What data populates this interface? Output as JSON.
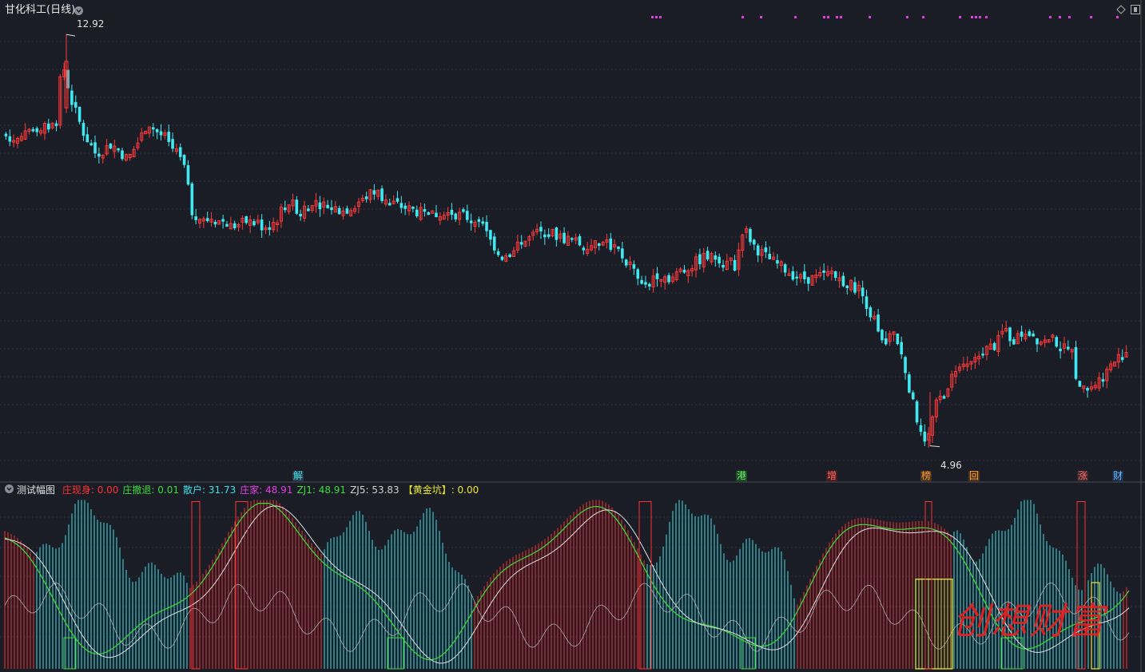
{
  "header": {
    "stock_title": "甘化科工(日线)",
    "high_label": "12.92",
    "low_label": "4.96"
  },
  "indicator": {
    "name": "测试幅图",
    "items": [
      {
        "label": "庄现身:",
        "value": "0.00",
        "color": "#ff3030"
      },
      {
        "label": "庄撤退:",
        "value": "0.01",
        "color": "#3cdc3c"
      },
      {
        "label": "散户:",
        "value": "31.73",
        "color": "#40e0e8"
      },
      {
        "label": "庄家:",
        "value": "48.91",
        "color": "#e040e0"
      },
      {
        "label": "ZJ1:",
        "value": "48.91",
        "color": "#3cdc3c"
      },
      {
        "label": "ZJ5:",
        "value": "53.83",
        "color": "#cfcfcf"
      },
      {
        "label": "【黄金坑】:",
        "value": "0.00",
        "color": "#e8e830"
      }
    ]
  },
  "event_tags": [
    {
      "text": "解",
      "color": "#40e0e8",
      "bg": "#2a3a48"
    },
    {
      "text": "港",
      "color": "#6cf06c",
      "bg": "#1d4a22"
    },
    {
      "text": "增",
      "color": "#ff6a6a",
      "bg": "#4a1d1d"
    },
    {
      "text": "榜",
      "color": "#ff9a3a",
      "bg": "#4a341d"
    },
    {
      "text": "回",
      "color": "#ff9a3a",
      "bg": "#4a341d"
    },
    {
      "text": "涨",
      "color": "#ff6a6a",
      "bg": "#3a2a2a"
    },
    {
      "text": "财",
      "color": "#6ab8ff",
      "bg": "#1d2e48"
    }
  ],
  "watermark": "创想财富",
  "colors": {
    "up": "#ff3a3a",
    "down": "#40e8f0",
    "signal": "#e040e0",
    "grid": "#30323c"
  },
  "chart_data": [
    {
      "type": "candlestick",
      "title": "甘化科工(日线)",
      "ylim": [
        4.6,
        13.2
      ],
      "y_axis_labels_shown": false,
      "max": 12.92,
      "min": 4.96,
      "approx_close_path": [
        [
          0,
          11.0
        ],
        [
          20,
          10.9
        ],
        [
          40,
          11.0
        ],
        [
          55,
          11.1
        ],
        [
          70,
          11.2
        ],
        [
          78,
          12.4
        ],
        [
          90,
          11.6
        ],
        [
          105,
          11.0
        ],
        [
          120,
          10.6
        ],
        [
          140,
          10.8
        ],
        [
          160,
          10.5
        ],
        [
          175,
          10.9
        ],
        [
          185,
          11.2
        ],
        [
          200,
          11.0
        ],
        [
          215,
          10.7
        ],
        [
          230,
          10.4
        ],
        [
          240,
          9.5
        ],
        [
          255,
          9.3
        ],
        [
          270,
          9.4
        ],
        [
          290,
          9.2
        ],
        [
          310,
          9.3
        ],
        [
          330,
          9.2
        ],
        [
          345,
          9.3
        ],
        [
          360,
          9.7
        ],
        [
          375,
          9.5
        ],
        [
          390,
          9.7
        ],
        [
          410,
          9.6
        ],
        [
          430,
          9.5
        ],
        [
          450,
          9.7
        ],
        [
          470,
          9.9
        ],
        [
          485,
          9.7
        ],
        [
          500,
          9.6
        ],
        [
          520,
          9.5
        ],
        [
          540,
          9.4
        ],
        [
          560,
          9.5
        ],
        [
          580,
          9.4
        ],
        [
          600,
          9.3
        ],
        [
          615,
          8.9
        ],
        [
          630,
          8.6
        ],
        [
          645,
          8.8
        ],
        [
          665,
          9.0
        ],
        [
          685,
          9.1
        ],
        [
          700,
          9.0
        ],
        [
          720,
          8.9
        ],
        [
          740,
          8.8
        ],
        [
          760,
          8.9
        ],
        [
          775,
          8.7
        ],
        [
          790,
          8.4
        ],
        [
          805,
          8.0
        ],
        [
          820,
          8.3
        ],
        [
          840,
          8.2
        ],
        [
          860,
          8.4
        ],
        [
          880,
          8.6
        ],
        [
          900,
          8.6
        ],
        [
          920,
          8.4
        ],
        [
          930,
          9.2
        ],
        [
          945,
          8.8
        ],
        [
          960,
          8.6
        ],
        [
          980,
          8.4
        ],
        [
          1000,
          8.2
        ],
        [
          1020,
          8.2
        ],
        [
          1040,
          8.3
        ],
        [
          1060,
          8.1
        ],
        [
          1075,
          8.0
        ],
        [
          1085,
          7.7
        ],
        [
          1095,
          7.3
        ],
        [
          1105,
          6.9
        ],
        [
          1115,
          7.1
        ],
        [
          1125,
          6.9
        ],
        [
          1135,
          6.3
        ],
        [
          1145,
          5.6
        ],
        [
          1155,
          5.2
        ],
        [
          1160,
          5.0
        ],
        [
          1170,
          5.7
        ],
        [
          1185,
          6.1
        ],
        [
          1200,
          6.6
        ],
        [
          1215,
          6.5
        ],
        [
          1230,
          6.8
        ],
        [
          1245,
          6.9
        ],
        [
          1255,
          7.1
        ],
        [
          1270,
          7.0
        ],
        [
          1285,
          7.2
        ],
        [
          1300,
          7.0
        ],
        [
          1320,
          7.0
        ],
        [
          1340,
          6.8
        ],
        [
          1352,
          6.0
        ],
        [
          1365,
          6.1
        ],
        [
          1380,
          6.3
        ],
        [
          1395,
          6.6
        ],
        [
          1410,
          6.8
        ]
      ]
    },
    {
      "type": "bar",
      "title": "测试幅图",
      "series": [
        {
          "name": "庄现身",
          "last": 0.0
        },
        {
          "name": "庄撤退",
          "last": 0.01
        },
        {
          "name": "散户",
          "last": 31.73
        },
        {
          "name": "庄家",
          "last": 48.91
        },
        {
          "name": "ZJ1",
          "last": 48.91
        },
        {
          "name": "ZJ5",
          "last": 53.83
        },
        {
          "name": "【黄金坑】",
          "last": 0.0
        }
      ],
      "ylim": [
        0,
        100
      ]
    }
  ]
}
